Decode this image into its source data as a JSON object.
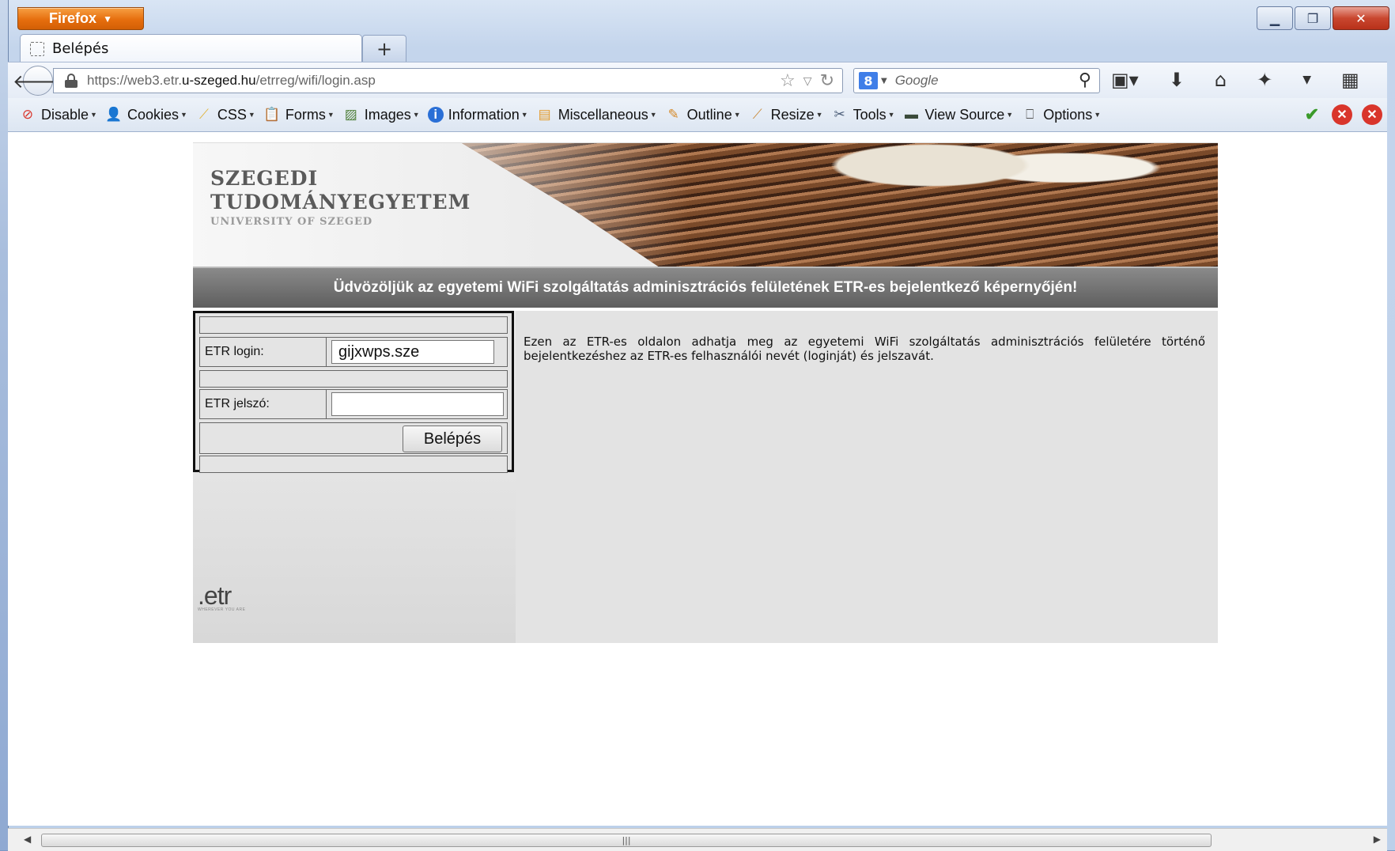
{
  "browser": {
    "menu_button": "Firefox",
    "tab_title": "Belépés",
    "new_tab_symbol": "+",
    "url_prefix": "https://web3.etr.",
    "url_domain": "u-szeged.hu",
    "url_path": "/etrreg/wifi/login.asp",
    "search_engine_letter": "8",
    "search_placeholder": "Google"
  },
  "devtoolbar": {
    "items": [
      {
        "label": "Disable",
        "icon": "disable-icon",
        "color": "#d9352b"
      },
      {
        "label": "Cookies",
        "icon": "cookies-icon",
        "color": "#333333"
      },
      {
        "label": "CSS",
        "icon": "css-icon",
        "color": "#e0b43a"
      },
      {
        "label": "Forms",
        "icon": "forms-icon",
        "color": "#d99a2b"
      },
      {
        "label": "Images",
        "icon": "images-icon",
        "color": "#4f7f3a"
      },
      {
        "label": "Information",
        "icon": "information-icon",
        "color": "#2a6fd6"
      },
      {
        "label": "Miscellaneous",
        "icon": "miscellaneous-icon",
        "color": "#e39a2a"
      },
      {
        "label": "Outline",
        "icon": "outline-icon",
        "color": "#d58a2a"
      },
      {
        "label": "Resize",
        "icon": "resize-icon",
        "color": "#c98a3a"
      },
      {
        "label": "Tools",
        "icon": "tools-icon",
        "color": "#4d5f7a"
      },
      {
        "label": "View Source",
        "icon": "view-source-icon",
        "color": "#3a4a3a"
      },
      {
        "label": "Options",
        "icon": "options-icon",
        "color": "#555555"
      }
    ]
  },
  "page": {
    "brand_line1": "SZEGEDI",
    "brand_line2": "TUDOMÁNYEGYETEM",
    "brand_line3": "UNIVERSITY OF SZEGED",
    "welcome": "Üdvözöljük az egyetemi WiFi szolgáltatás adminisztrációs felületének ETR-es bejelentkező képernyőjén!",
    "login_label": "ETR login:",
    "login_value": "gijxwps.sze",
    "password_label": "ETR jelszó:",
    "password_value": "",
    "submit_label": "Belépés",
    "info_text": "Ezen az ETR-es oldalon adhatja meg az egyetemi WiFi szolgáltatás adminisztrációs felületére történő bejelentkezéshez az ETR-es felhasználói nevét (loginját) és jelszavát.",
    "footer_logo": ".etr",
    "footer_tagline": "WHEREVER YOU ARE"
  }
}
